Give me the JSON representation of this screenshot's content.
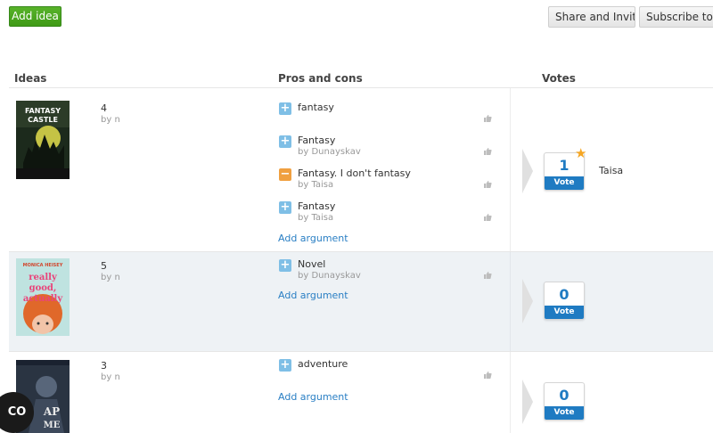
{
  "toolbar": {
    "add_idea": "Add idea",
    "share": "Share and Invite",
    "subscribe": "Subscribe to updates"
  },
  "columns": {
    "ideas": "Ideas",
    "pros_cons": "Pros and cons",
    "votes": "Votes"
  },
  "ideas": [
    {
      "cover_art": "fantasy-castle-cover",
      "cover_title": "FANTASY CASTLE",
      "number": "4",
      "author": "by n",
      "arguments": [
        {
          "type": "pro",
          "text": "fantasy",
          "by": ""
        },
        {
          "type": "pro",
          "text": "Fantasy",
          "by": "by Dunayskav"
        },
        {
          "type": "con",
          "text": "Fantasy. I don't fantasy",
          "by": "by Taisa"
        },
        {
          "type": "pro",
          "text": "Fantasy",
          "by": "by Taisa"
        }
      ],
      "add_argument": "Add argument",
      "votes": "1",
      "vote_label": "Vote",
      "voters": [
        "Taisa"
      ],
      "starred": true
    },
    {
      "cover_art": "really-good-actually-cover",
      "cover_author": "MONICA HEISEY",
      "cover_title": "really good, actually",
      "number": "5",
      "author": "by n",
      "arguments": [
        {
          "type": "pro",
          "text": "Novel",
          "by": "by Dunayskav"
        }
      ],
      "add_argument": "Add argument",
      "votes": "0",
      "vote_label": "Vote",
      "voters": [],
      "starred": false
    },
    {
      "cover_art": "map-cover",
      "number": "3",
      "author": "by n",
      "arguments": [
        {
          "type": "pro",
          "text": "adventure",
          "by": ""
        }
      ],
      "add_argument": "Add argument",
      "votes": "0",
      "vote_label": "Vote",
      "voters": [],
      "starred": false
    }
  ],
  "badge": {
    "label": "CO"
  },
  "colors": {
    "accent_green": "#4aa620",
    "vote_blue": "#1f7bc2",
    "highlight_row": "#eef2f5",
    "pro_icon": "#7fbfe6",
    "con_icon": "#f0a040"
  }
}
